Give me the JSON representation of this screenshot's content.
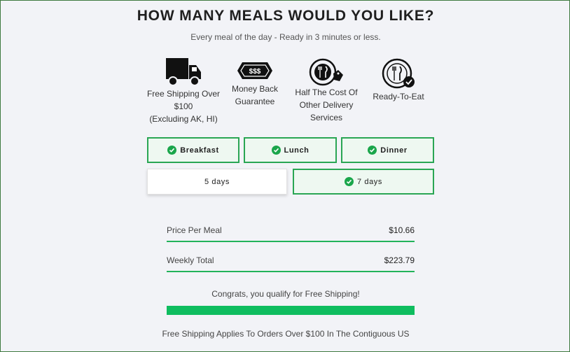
{
  "header": {
    "title": "HOW MANY MEALS WOULD YOU LIKE?",
    "subtitle": "Every meal of the day - Ready in 3 minutes or less."
  },
  "features": [
    {
      "icon": "truck-icon",
      "lines": [
        "Free Shipping Over",
        "$100",
        "(Excluding AK, HI)"
      ]
    },
    {
      "icon": "money-back-badge-icon",
      "lines": [
        "Money Back",
        "Guarantee"
      ]
    },
    {
      "icon": "plate-price-tag-icon",
      "lines": [
        "Half The Cost Of",
        "Other Delivery",
        "Services"
      ]
    },
    {
      "icon": "plate-check-icon",
      "lines": [
        "Ready-To-Eat"
      ]
    }
  ],
  "badge_text": "$$$",
  "meal_options": [
    {
      "label": "Breakfast",
      "selected": true
    },
    {
      "label": "Lunch",
      "selected": true
    },
    {
      "label": "Dinner",
      "selected": true
    }
  ],
  "day_options": [
    {
      "label": "5 days",
      "selected": false
    },
    {
      "label": "7 days",
      "selected": true
    }
  ],
  "summary": {
    "price_label": "Price Per Meal",
    "price_value": "$10.66",
    "total_label": "Weekly Total",
    "total_value": "$223.79"
  },
  "shipping": {
    "message": "Congrats, you qualify for Free Shipping!",
    "progress": 1.0,
    "note": "Free Shipping Applies To Orders Over $100 In The Contiguous US"
  },
  "colors": {
    "accent": "#1aa64b",
    "progress": "#0fbd5f",
    "border": "#3f7a3f"
  }
}
